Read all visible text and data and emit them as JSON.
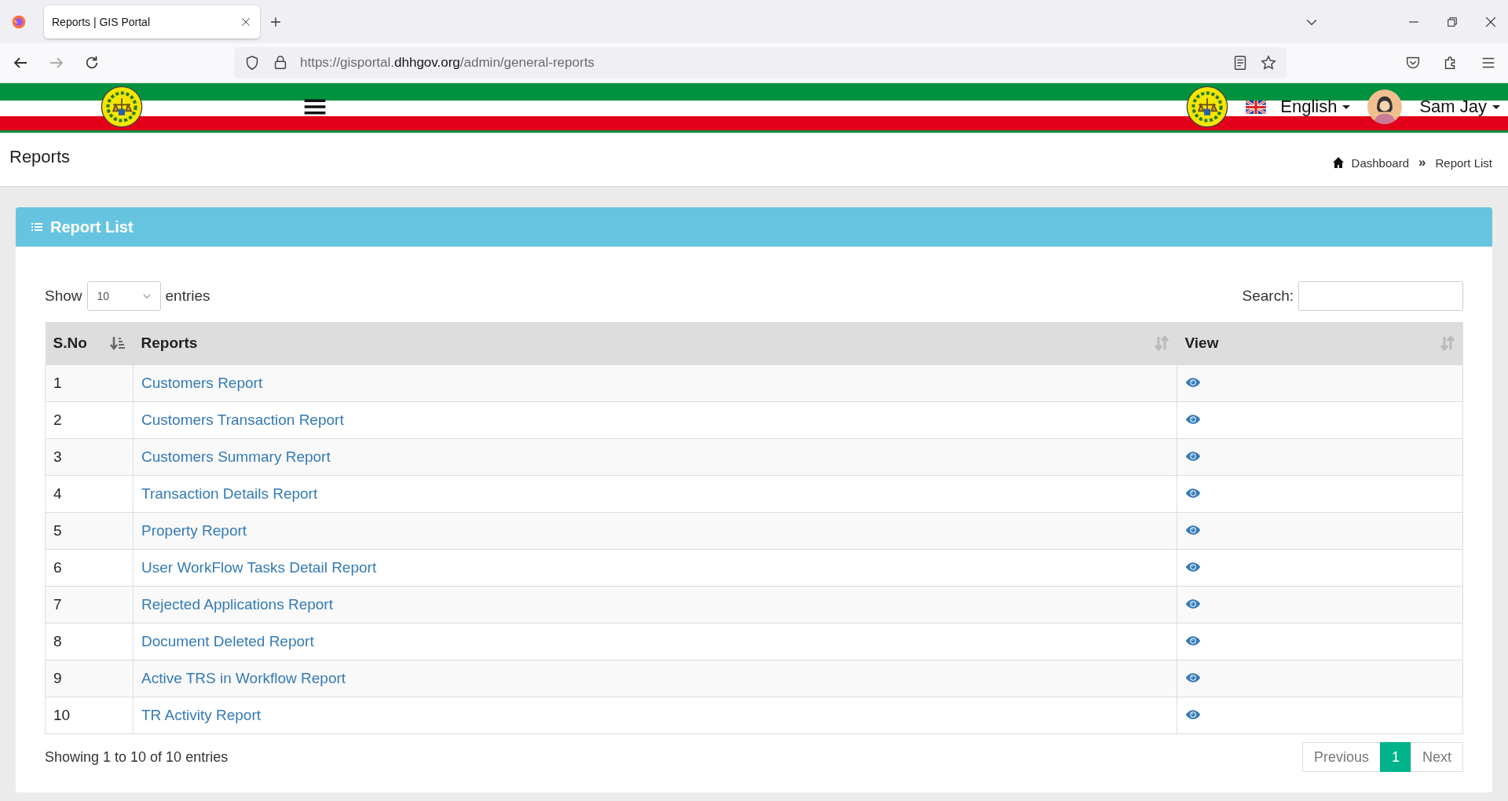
{
  "browser": {
    "tab_title": "Reports | GIS Portal",
    "url_prefix": "https://gisportal.",
    "url_domain": "dhhgov.org",
    "url_path": "/admin/general-reports"
  },
  "header": {
    "language": "English",
    "user": "Sam Jay"
  },
  "page": {
    "title": "Reports",
    "breadcrumb": [
      {
        "label": "Dashboard"
      },
      {
        "label": "Report List"
      }
    ],
    "separator": "»"
  },
  "card": {
    "title": "Report List",
    "length": {
      "label_before": "Show",
      "value": "10",
      "label_after": "entries"
    },
    "search": {
      "label": "Search:"
    },
    "columns": [
      {
        "label": "S.No",
        "sorted": true
      },
      {
        "label": "Reports",
        "sorted": false
      },
      {
        "label": "View",
        "sorted": false
      }
    ],
    "rows": [
      {
        "no": "1",
        "report": "Customers Report"
      },
      {
        "no": "2",
        "report": "Customers Transaction Report"
      },
      {
        "no": "3",
        "report": "Customers Summary Report"
      },
      {
        "no": "4",
        "report": "Transaction Details Report"
      },
      {
        "no": "5",
        "report": "Property Report"
      },
      {
        "no": "6",
        "report": "User WorkFlow Tasks Detail Report"
      },
      {
        "no": "7",
        "report": "Rejected Applications Report"
      },
      {
        "no": "8",
        "report": "Document Deleted Report"
      },
      {
        "no": "9",
        "report": "Active TRS in Workflow Report"
      },
      {
        "no": "10",
        "report": "TR Activity Report"
      }
    ],
    "info": "Showing 1 to 10 of 10 entries",
    "pagination": [
      {
        "label": "Previous",
        "selected": false
      },
      {
        "label": "1",
        "selected": true
      },
      {
        "label": "Next",
        "selected": false
      }
    ]
  }
}
